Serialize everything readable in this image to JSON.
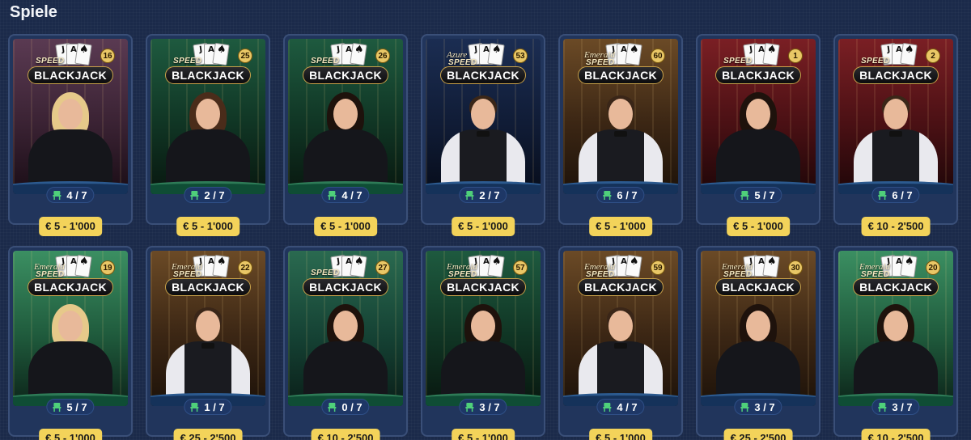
{
  "page_title": "Spiele",
  "games": [
    {
      "name_top": "",
      "speed": "SPEED",
      "title": "BLACKJACK",
      "table_number": "16",
      "seats": "4 / 7",
      "limits": "€ 5 - 1'000",
      "theme": "purple",
      "dealer": "female-blonde",
      "table": "blue"
    },
    {
      "name_top": "",
      "speed": "SPEED",
      "title": "BLACKJACK",
      "table_number": "25",
      "seats": "2 / 7",
      "limits": "€ 5 - 1'000",
      "theme": "green",
      "dealer": "female-curly",
      "table": "green"
    },
    {
      "name_top": "",
      "speed": "SPEED",
      "title": "BLACKJACK",
      "table_number": "26",
      "seats": "4 / 7",
      "limits": "€ 5 - 1'000",
      "theme": "green",
      "dealer": "female-dark",
      "table": "green"
    },
    {
      "name_top": "Azure",
      "speed": "SPEED",
      "title": "BLACKJACK",
      "table_number": "53",
      "seats": "2 / 7",
      "limits": "€ 5 - 1'000",
      "theme": "blue",
      "dealer": "male",
      "table": "blue"
    },
    {
      "name_top": "Emerald",
      "speed": "SPEED",
      "title": "BLACKJACK",
      "table_number": "60",
      "seats": "6 / 7",
      "limits": "€ 5 - 1'000",
      "theme": "gold",
      "dealer": "male",
      "table": "blue"
    },
    {
      "name_top": "",
      "speed": "SPEED",
      "title": "BLACKJACK",
      "table_number": "1",
      "seats": "5 / 7",
      "limits": "€ 5 - 1'000",
      "theme": "red",
      "dealer": "female-dark",
      "table": "blue"
    },
    {
      "name_top": "",
      "speed": "SPEED",
      "title": "BLACKJACK",
      "table_number": "2",
      "seats": "6 / 7",
      "limits": "€ 10 - 2'500",
      "theme": "red",
      "dealer": "male",
      "table": "blue"
    },
    {
      "name_top": "Emerald",
      "speed": "SPEED",
      "title": "BLACKJACK",
      "table_number": "19",
      "seats": "5 / 7",
      "limits": "€ 5 - 1'000",
      "theme": "emerald",
      "dealer": "female-blonde",
      "table": "green"
    },
    {
      "name_top": "Emerald",
      "speed": "SPEED",
      "title": "BLACKJACK",
      "table_number": "22",
      "seats": "1 / 7",
      "limits": "€ 25 - 2'500",
      "theme": "gold",
      "dealer": "male",
      "table": "blue"
    },
    {
      "name_top": "",
      "speed": "SPEED",
      "title": "BLACKJACK",
      "table_number": "27",
      "seats": "0 / 7",
      "limits": "€ 10 - 2'500",
      "theme": "teal",
      "dealer": "female-dark",
      "table": "green"
    },
    {
      "name_top": "Emerald",
      "speed": "SPEED",
      "title": "BLACKJACK",
      "table_number": "57",
      "seats": "3 / 7",
      "limits": "€ 5 - 1'000",
      "theme": "green",
      "dealer": "female-dark",
      "table": "green"
    },
    {
      "name_top": "Emerald",
      "speed": "SPEED",
      "title": "BLACKJACK",
      "table_number": "59",
      "seats": "4 / 7",
      "limits": "€ 5 - 1'000",
      "theme": "gold",
      "dealer": "male",
      "table": "blue"
    },
    {
      "name_top": "Emerald",
      "speed": "SPEED",
      "title": "BLACKJACK",
      "table_number": "30",
      "seats": "3 / 7",
      "limits": "€ 25 - 2'500",
      "theme": "gold",
      "dealer": "female-dark",
      "table": "blue"
    },
    {
      "name_top": "Emerald",
      "speed": "SPEED",
      "title": "BLACKJACK",
      "table_number": "20",
      "seats": "3 / 7",
      "limits": "€ 10 - 2'500",
      "theme": "emerald",
      "dealer": "female-dark",
      "table": "green"
    }
  ],
  "card_faces": [
    "J",
    "A",
    "♠"
  ],
  "colors": {
    "background": "#1b2a4a",
    "limit_badge": "#f3d35a",
    "seat_pill": "#1e3766",
    "logo_border": "#c9a24a"
  }
}
